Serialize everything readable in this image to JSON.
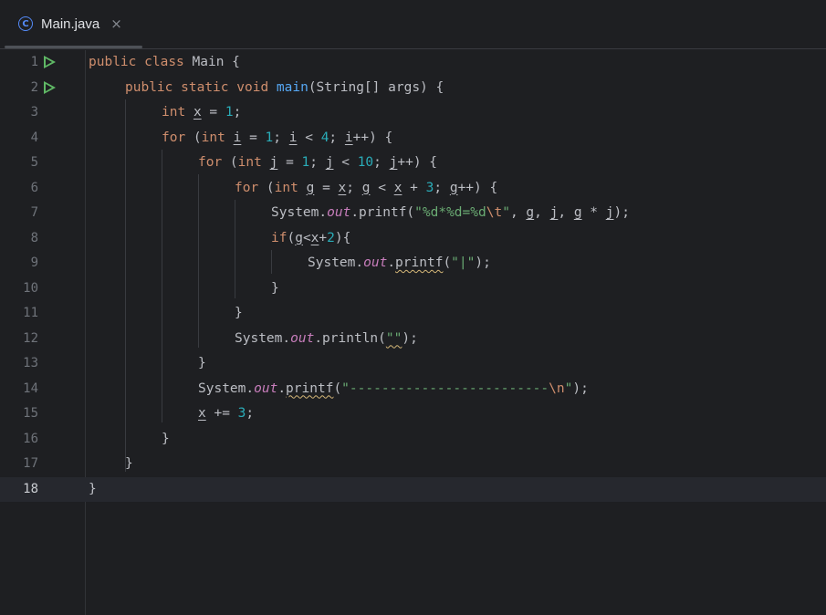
{
  "tab": {
    "label": "Main.java",
    "icon": "class-icon",
    "icon_glyph": "C",
    "close_glyph": "×"
  },
  "line_numbers": [
    "1",
    "2",
    "3",
    "4",
    "5",
    "6",
    "7",
    "8",
    "9",
    "10",
    "11",
    "12",
    "13",
    "14",
    "15",
    "16",
    "17",
    "18"
  ],
  "code": {
    "l1": [
      "public",
      "class",
      "Main {"
    ],
    "l2": [
      "public",
      "static",
      "void",
      "main",
      "(String[] args) {"
    ],
    "l3": [
      "int",
      "x",
      " = ",
      "1",
      ";"
    ],
    "l4": [
      "for",
      " (",
      "int",
      "i",
      " = ",
      "1",
      "; ",
      "i",
      " < ",
      "4",
      "; ",
      "i",
      "++) {"
    ],
    "l5": [
      "for",
      " (",
      "int",
      "j",
      " = ",
      "1",
      "; ",
      "j",
      " < ",
      "10",
      "; ",
      "j",
      "++) {"
    ],
    "l6": [
      "for",
      " (",
      "int",
      "g",
      " = ",
      "x",
      "; ",
      "g",
      " < ",
      "x",
      " + ",
      "3",
      "; ",
      "g",
      "++) {"
    ],
    "l7": [
      "System.",
      "out",
      ".printf(",
      "\"%d*%d=%d",
      "\\t",
      "\"",
      ", ",
      "g",
      ", ",
      "j",
      ", ",
      "g",
      " * ",
      "j",
      ");"
    ],
    "l8": [
      "if",
      "(",
      "g",
      "<",
      "x",
      "+",
      "2",
      "){"
    ],
    "l9": [
      "System.",
      "out",
      ".",
      "printf",
      "(",
      "\"|\"",
      ");"
    ],
    "l10": [
      "}"
    ],
    "l11": [
      "}"
    ],
    "l12": [
      "System.",
      "out",
      ".println(",
      "\"\"",
      ");"
    ],
    "l13": [
      "}"
    ],
    "l14": [
      "System.",
      "out",
      ".",
      "printf",
      "(",
      "\"-------------------------",
      "\\n",
      "\"",
      ");"
    ],
    "l15": [
      "x",
      " += ",
      "3",
      ";"
    ],
    "l16": [
      "}"
    ],
    "l17": [
      "}"
    ],
    "l18": [
      "}"
    ]
  },
  "colors": {
    "background": "#1e1f22",
    "keyword": "#cf8e6d",
    "method": "#56a8f5",
    "number": "#2aacb8",
    "string": "#6aab73",
    "field": "#c77dbb",
    "run_icon": "#5fb865"
  },
  "current_line": 18
}
